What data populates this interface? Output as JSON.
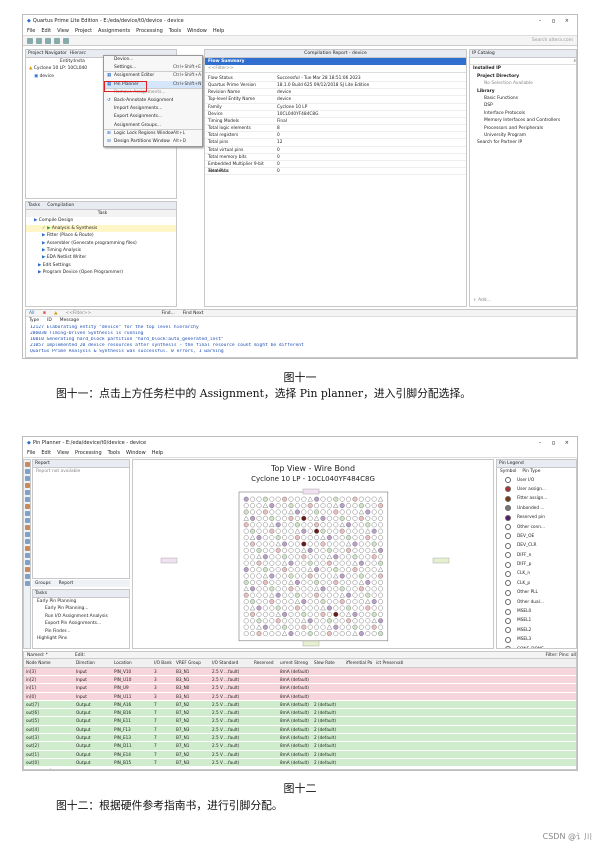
{
  "figure1": {
    "window_title": "Quartus Prime Lite Edition - E:/eda/device/t0/device - device",
    "win_controls": [
      "–",
      "ㅁ",
      "×"
    ],
    "search_hint": "Search altera.com",
    "menu": [
      "File",
      "Edit",
      "View",
      "Project",
      "Assignments",
      "Processing",
      "Tools",
      "Window",
      "Help"
    ],
    "nav_title": "Project Navigator",
    "nav_tab": "Hierarc",
    "nav_entity_label": "Entity:Insta",
    "nav_device": "Cyclone 10 LP: 10CL040",
    "nav_entity": "device",
    "dropdown": [
      {
        "label": "Device...",
        "shortcut": ""
      },
      {
        "label": "Settings...",
        "shortcut": "Ctrl+Shift+E"
      },
      {
        "label": "Assignment Editor",
        "shortcut": "Ctrl+Shift+A"
      },
      {
        "label": "Pin Planner",
        "shortcut": "Ctrl+Shift+N"
      },
      {
        "label": "Remove Assignments...",
        "shortcut": ""
      },
      {
        "label": "Back-Annotate Assignments...",
        "shortcut": ""
      },
      {
        "label": "Import Assignments...",
        "shortcut": ""
      },
      {
        "label": "Export Assignments...",
        "shortcut": ""
      },
      {
        "label": "Assignment Groups...",
        "shortcut": ""
      },
      {
        "label": "Logic Lock Regions Window",
        "shortcut": "Alt+L"
      },
      {
        "label": "Design Partitions Window",
        "shortcut": "Alt+D"
      }
    ],
    "report_tab": "Compilation Report - device",
    "report_items": [
      "Flow Summary",
      "<<Filter>>"
    ],
    "flow_summary": [
      [
        "Flow Status",
        "Successful - Tue Mar 28 18:51:06 2023"
      ],
      [
        "Quartus Prime Version",
        "18.1.0 Build 625 09/12/2018 SJ Lite Edition"
      ],
      [
        "Revision Name",
        "device"
      ],
      [
        "Top-level Entity Name",
        "device"
      ],
      [
        "Family",
        "Cyclone 10 LP"
      ],
      [
        "Device",
        "10CL040YF484C8G"
      ],
      [
        "Timing Models",
        "Final"
      ],
      [
        "Total logic elements",
        "8"
      ],
      [
        "Total registers",
        "0"
      ],
      [
        "Total pins",
        "12"
      ],
      [
        "Total virtual pins",
        "0"
      ],
      [
        "Total memory bits",
        "0"
      ],
      [
        "Embedded Multiplier 9-bit elements",
        "0"
      ],
      [
        "Total PLLs",
        "0"
      ]
    ],
    "ip_title": "IP Catalog",
    "ip_items": [
      "Installed IP",
      "Project Directory",
      "No Selection Available",
      "Library",
      "Basic Functions",
      "DSP",
      "Interface Protocols",
      "Memory Interfaces and Controllers",
      "Processors and Peripherals",
      "University Program",
      "Search for Partner IP"
    ],
    "ip_add": "+ Add...",
    "tasks_title": "Tasks",
    "tasks_flow": "Compilation",
    "tasks_col": "Task",
    "tasks": [
      "Compile Design",
      "Analysis & Synthesis",
      "Fitter (Place & Route)",
      "Assembler (Generate programming files)",
      "Timing Analysis",
      "EDA Netlist Writer",
      "Edit Settings",
      "Program Device (Open Programmer)"
    ],
    "msg_filter": "<<Filter>>",
    "msg_find": "Find...",
    "msg_find_next": "Find Next",
    "msg_cols": [
      "Type",
      "ID",
      "Message"
    ],
    "messages": [
      "12127 Elaborating entity \"device\" for the top level hierarchy",
      "286030 Timing-Driven Synthesis is running",
      "16010 Generating hard_block partition \"hard_block:auto_generated_inst\"",
      "21057 Implemented 20 device resources after synthesis - the final resource count might be different",
      "       Quartus Prime Analysis & Synthesis was successful. 0 errors, 1 warning"
    ],
    "caption": "图十一",
    "description": "图十一：点击上方任务栏中的 Assignment，选择 Pin planner，进入引脚分配选择。"
  },
  "figure2": {
    "window_title": "Pin Planner - E:/eda/device/t0/device - device",
    "win_controls": [
      "–",
      "ㅁ",
      "×"
    ],
    "search_hint": "Search altera.com",
    "menu": [
      "File",
      "Edit",
      "View",
      "Processing",
      "Tools",
      "Window",
      "Help"
    ],
    "report_title": "Report",
    "report_empty": "Report not available",
    "groups_tabs": [
      "Groups",
      "Report"
    ],
    "tasks_title": "Tasks",
    "tasks": [
      "Early Pin Planning",
      "Early Pin Planning...",
      "Run I/O Assignment Analysis",
      "Export Pin Assignments...",
      "Pin Finder...",
      "Highlight Pins"
    ],
    "view_title": "Top View - Wire Bond",
    "view_subtitle": "Cyclone 10 LP - 10CL040YF484C8G",
    "legend_title": "Pin Legend",
    "legend_cols": [
      "Symbol",
      "Pin Type"
    ],
    "legend": [
      {
        "label": "User I/O",
        "color": "#ffffff"
      },
      {
        "label": "User assign...",
        "color": "#b03030"
      },
      {
        "label": "Fitter assign...",
        "color": "#7a3a10"
      },
      {
        "label": "Unbonded ...",
        "color": "#777777"
      },
      {
        "label": "Reserved pin",
        "color": "#5a1a6a"
      },
      {
        "label": "Other conn...",
        "color": "#ffffff"
      },
      {
        "label": "DEV_OE",
        "color": "#ffffff"
      },
      {
        "label": "DEV_CLR",
        "color": "#ffffff"
      },
      {
        "label": "DIFF_n",
        "color": "#ffffff"
      },
      {
        "label": "DIFF_p",
        "color": "#ffffff"
      },
      {
        "label": "CLK_n",
        "color": "#ffffff"
      },
      {
        "label": "CLK_p",
        "color": "#ffffff"
      },
      {
        "label": "Other PLL",
        "color": "#ffffff"
      },
      {
        "label": "Other dual...",
        "color": "#ffffff"
      },
      {
        "label": "MSEL0",
        "color": "#ffffff"
      },
      {
        "label": "MSEL1",
        "color": "#ffffff"
      },
      {
        "label": "MSEL2",
        "color": "#ffffff"
      },
      {
        "label": "MSEL3",
        "color": "#ffffff"
      },
      {
        "label": "CONF_DONE",
        "color": "#ffffff"
      },
      {
        "label": "nCE",
        "color": "#ffffff"
      }
    ],
    "named_label": "Named: *",
    "edit_label": "Edit:",
    "filter_label": "Filter: Pins: all",
    "pin_cols": [
      "Node Name",
      "Direction",
      "Location",
      "I/O Bank",
      "VREF Group",
      "I/O Standard",
      "Reserved",
      "urrent Streng",
      "Slew Rate",
      "ifferential Pa",
      "ict Preservati"
    ],
    "pins": [
      [
        "in[3]",
        "Input",
        "PIN_V10",
        "3",
        "B3_N1",
        "2.5 V ...fault)",
        "",
        "8mA (default)",
        "",
        "",
        ""
      ],
      [
        "in[2]",
        "Input",
        "PIN_U10",
        "3",
        "B3_N1",
        "2.5 V ...fault)",
        "",
        "8mA (default)",
        "",
        "",
        ""
      ],
      [
        "in[1]",
        "Input",
        "PIN_U9",
        "3",
        "B3_N0",
        "2.5 V ...fault)",
        "",
        "8mA (default)",
        "",
        "",
        ""
      ],
      [
        "in[0]",
        "Input",
        "PIN_U11",
        "3",
        "B3_N1",
        "2.5 V ...fault)",
        "",
        "8mA (default)",
        "",
        "",
        ""
      ],
      [
        "out[7]",
        "Output",
        "PIN_A16",
        "7",
        "B7_N2",
        "2.5 V ...fault)",
        "",
        "8mA (default)",
        "2 (default)",
        "",
        ""
      ],
      [
        "out[6]",
        "Output",
        "PIN_B16",
        "7",
        "B7_N2",
        "2.5 V ...fault)",
        "",
        "8mA (default)",
        "2 (default)",
        "",
        ""
      ],
      [
        "out[5]",
        "Output",
        "PIN_E11",
        "7",
        "B7_N2",
        "2.5 V ...fault)",
        "",
        "8mA (default)",
        "2 (default)",
        "",
        ""
      ],
      [
        "out[4]",
        "Output",
        "PIN_F13",
        "7",
        "B7_N3",
        "2.5 V ...fault)",
        "",
        "8mA (default)",
        "2 (default)",
        "",
        ""
      ],
      [
        "out[3]",
        "Output",
        "PIN_E13",
        "7",
        "B7_N1",
        "2.5 V ...fault)",
        "",
        "8mA (default)",
        "2 (default)",
        "",
        ""
      ],
      [
        "out[2]",
        "Output",
        "PIN_D11",
        "7",
        "B7_N1",
        "2.5 V ...fault)",
        "",
        "8mA (default)",
        "2 (default)",
        "",
        ""
      ],
      [
        "out[1]",
        "Output",
        "PIN_E14",
        "7",
        "B7_N2",
        "2.5 V ...fault)",
        "",
        "8mA (default)",
        "2 (default)",
        "",
        ""
      ],
      [
        "out[0]",
        "Output",
        "PIN_B15",
        "7",
        "B7_N3",
        "2.5 V ...fault)",
        "",
        "8mA (default)",
        "2 (default)",
        "",
        ""
      ],
      [
        "<<new node>>",
        "",
        "",
        "",
        "",
        "",
        "",
        "",
        "",
        "",
        ""
      ]
    ],
    "caption": "图十二",
    "description": "图十二：根据硬件参考指南书，进行引脚分配。"
  },
  "colors": {
    "input_row": "#f6d6dc",
    "output_row": "#cfeccd",
    "highlight": "#2f6fd0",
    "callout": "#e02020"
  },
  "watermark": "CSDN @讠川"
}
